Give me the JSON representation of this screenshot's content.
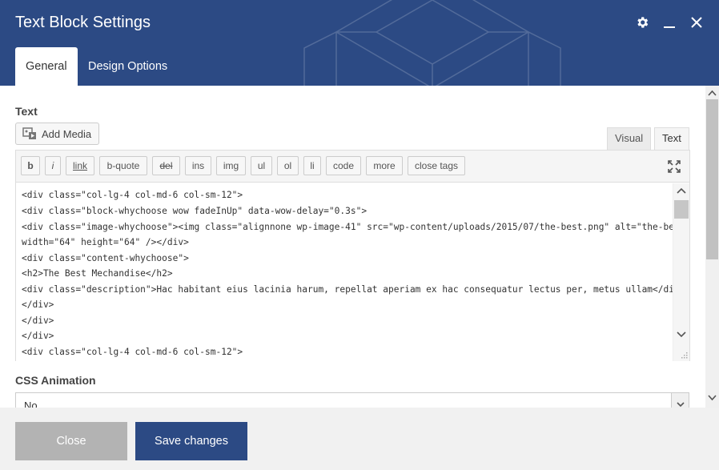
{
  "window": {
    "title": "Text Block Settings"
  },
  "header_icons": [
    "gear-icon",
    "minimize-icon",
    "close-icon"
  ],
  "tabs": [
    {
      "label": "General",
      "active": true
    },
    {
      "label": "Design Options",
      "active": false
    }
  ],
  "text_section": {
    "label": "Text",
    "add_media_label": "Add Media",
    "mode_tabs": [
      {
        "label": "Visual",
        "active": false
      },
      {
        "label": "Text",
        "active": true
      }
    ],
    "quicktags": [
      "b",
      "i",
      "link",
      "b-quote",
      "del",
      "ins",
      "img",
      "ul",
      "ol",
      "li",
      "code",
      "more",
      "close tags"
    ],
    "code_lines": [
      "<div class=\"col-lg-4 col-md-6 col-sm-12\">",
      "<div class=\"block-whychoose wow fadeInUp\" data-wow-delay=\"0.3s\">",
      "<div class=\"image-whychoose\"><img class=\"alignnone wp-image-41\" src=\"wp-content/uploads/2015/07/the-best.png\" alt=\"the-best\"",
      "width=\"64\" height=\"64\" /></div>",
      "<div class=\"content-whychoose\">",
      "<h2>The Best Mechandise</h2>",
      "<div class=\"description\">Hac habitant eius lacinia harum, repellat aperiam ex hac consequatur lectus per, metus ullam</div>",
      "</div>",
      "</div>",
      "</div>",
      "<div class=\"col-lg-4 col-md-6 col-sm-12\">"
    ]
  },
  "css_animation": {
    "label": "CSS Animation",
    "selected": "No"
  },
  "footer": {
    "close_label": "Close",
    "save_label": "Save changes"
  },
  "colors": {
    "header_bg": "#2c4a84",
    "save_button": "#2c4a84",
    "close_button": "#b3b3b3"
  }
}
